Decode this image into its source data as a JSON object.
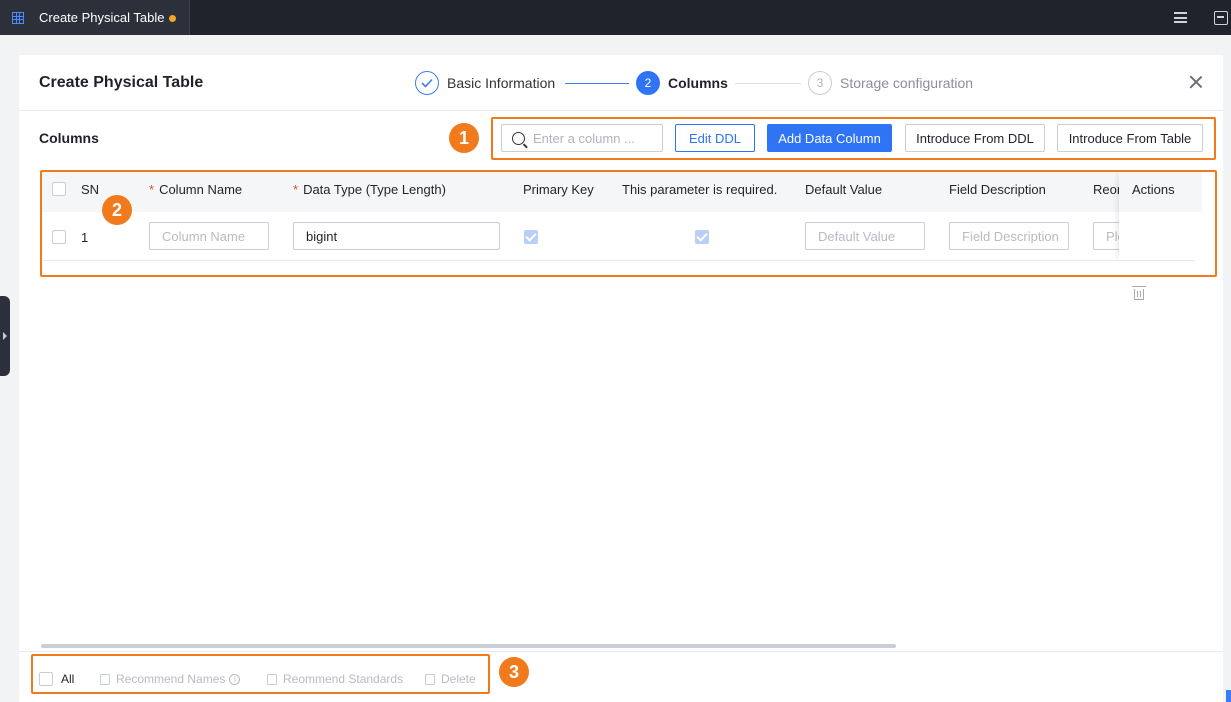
{
  "topbar": {
    "tab_title": "Create Physical Table",
    "unsaved_indicator_color": "#f5a623"
  },
  "dialog": {
    "title": "Create Physical Table",
    "steps": [
      {
        "number": "1",
        "label": "Basic Information",
        "state": "done"
      },
      {
        "number": "2",
        "label": "Columns",
        "state": "active"
      },
      {
        "number": "3",
        "label": "Storage configuration",
        "state": "pending"
      }
    ]
  },
  "columns": {
    "section_title": "Columns",
    "search_placeholder": "Enter a column ...",
    "buttons": {
      "edit_ddl": "Edit DDL",
      "add_data_column": "Add Data Column",
      "introduce_from_ddl": "Introduce From DDL",
      "introduce_from_table": "Introduce From Table"
    },
    "table": {
      "headers": {
        "sn": "SN",
        "column_name": "Column Name",
        "data_type": "Data Type (Type Length)",
        "primary_key": "Primary Key",
        "required": "This parameter is required.",
        "default_value": "Default Value",
        "field_description": "Field Description",
        "recommend_truncated": "Reon",
        "actions": "Actions"
      },
      "rows": [
        {
          "sn": "1",
          "column_name_placeholder": "Column Name",
          "data_type": "bigint",
          "primary_key": true,
          "required": true,
          "default_value_placeholder": "Default Value",
          "field_description_placeholder": "Field Description",
          "truncated_placeholder": "Ple"
        }
      ]
    }
  },
  "footer": {
    "all": "All",
    "recommend_names": "Recommend Names",
    "recommend_standards": "Reommend Standards",
    "delete": "Delete"
  },
  "annotations": [
    "1",
    "2",
    "3"
  ],
  "colors": {
    "accent": "#2f74f5",
    "annotation": "#f07a1c",
    "topbar": "#1f232b"
  }
}
